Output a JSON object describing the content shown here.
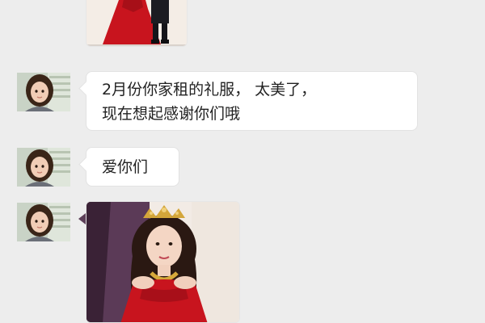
{
  "messages": [
    {
      "type": "image",
      "image": "photo-red-gown-and-suit-couple"
    },
    {
      "type": "text",
      "avatar": "girl-avatar",
      "lines": [
        "2月份你家租的礼服， 太美了，",
        "现在想起感谢你们哦"
      ]
    },
    {
      "type": "text",
      "avatar": "girl-avatar",
      "lines": [
        "爱你们"
      ]
    },
    {
      "type": "image",
      "avatar": "girl-avatar",
      "image": "photo-woman-crown-red-gown"
    }
  ],
  "colors": {
    "background": "#ededed",
    "bubble": "#ffffff",
    "gown_red": "#c8141e"
  }
}
